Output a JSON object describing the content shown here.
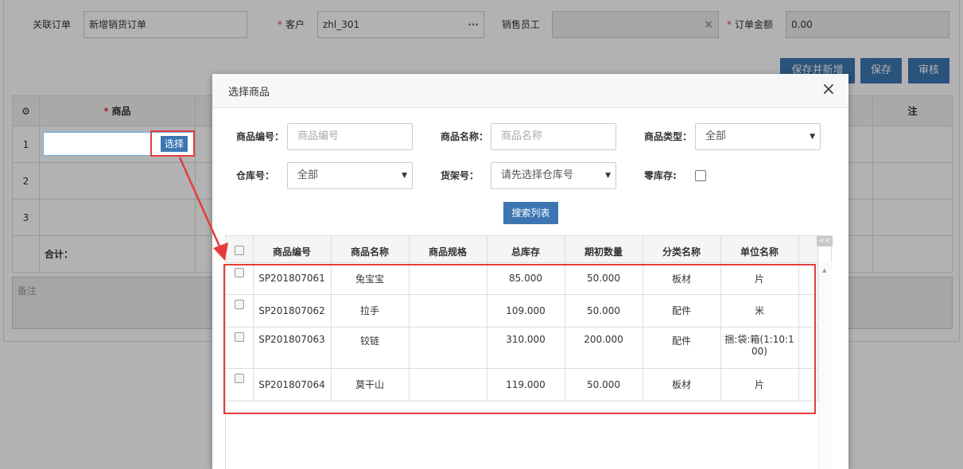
{
  "form": {
    "related_order_label": "关联订单",
    "related_order_value": "新增销货订单",
    "customer_label": "客户",
    "customer_value": "zhl_301",
    "customer_suffix": "···",
    "salesman_label": "销售员工",
    "salesman_clear": "×",
    "amount_label": "订单金额",
    "amount_value": "0.00",
    "required_mark": "*",
    "buttons": {
      "save_new": "保存并新增",
      "save": "保存",
      "audit": "审核"
    }
  },
  "grid": {
    "gear_icon": "gear-icon",
    "product_header": "商品",
    "last_header_fragment": "注",
    "rows": [
      "1",
      "2",
      "3"
    ],
    "total_label": "合计：",
    "select_button": "选择",
    "memo_placeholder": "备注"
  },
  "modal": {
    "title": "选择商品",
    "close": "×",
    "filters": {
      "code_label": "商品编号：",
      "code_placeholder": "商品编号",
      "name_label": "商品名称：",
      "name_placeholder": "商品名称",
      "type_label": "商品类型：",
      "type_value": "全部",
      "warehouse_label": "仓库号：",
      "warehouse_value": "全部",
      "shelf_label": "货架号：",
      "shelf_value": "请先选择仓库号",
      "zero_stock_label": "零库存:",
      "caret": "▼"
    },
    "search_button": "搜索列表",
    "collapse": "<<",
    "table": {
      "headers": [
        "商品编号",
        "商品名称",
        "商品规格",
        "总库存",
        "期初数量",
        "分类名称",
        "单位名称"
      ],
      "rows": [
        {
          "code": "SP201807061",
          "name": "兔宝宝",
          "spec": "",
          "stock": "85.000",
          "initial": "50.000",
          "category": "板材",
          "unit": "片"
        },
        {
          "code": "SP201807062",
          "name": "拉手",
          "spec": "",
          "stock": "109.000",
          "initial": "50.000",
          "category": "配件",
          "unit": "米"
        },
        {
          "code": "SP201807063",
          "name": "铰链",
          "spec": "",
          "stock": "310.000",
          "initial": "200.000",
          "category": "配件",
          "unit": "捆:袋:箱(1:10:100)"
        },
        {
          "code": "SP201807064",
          "name": "莫干山",
          "spec": "",
          "stock": "119.000",
          "initial": "50.000",
          "category": "板材",
          "unit": "片"
        }
      ]
    }
  },
  "colors": {
    "primary": "#3c76b2",
    "highlight": "#e63b3b"
  }
}
